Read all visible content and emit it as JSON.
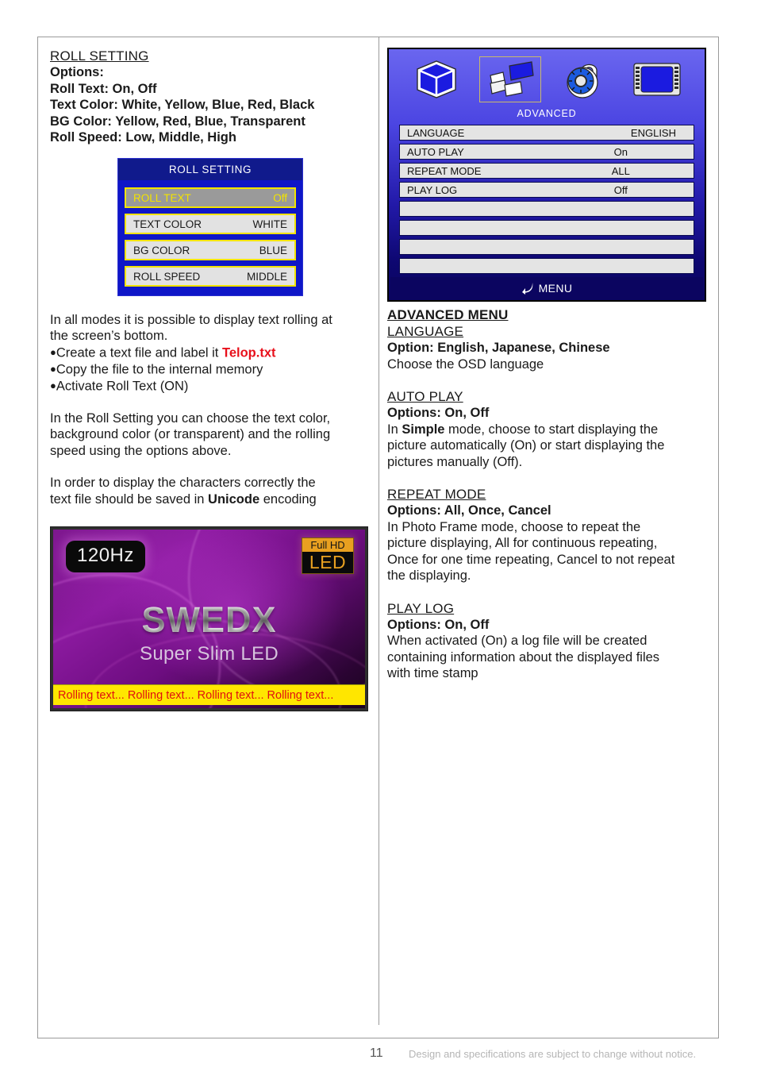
{
  "left": {
    "heading": "ROLL SETTING",
    "options_label": "Options:",
    "option_lines": [
      "Roll Text: On, Off",
      "Text Color: White, Yellow, Blue, Red, Black",
      "BG Color: Yellow, Red, Blue, Transparent",
      "Roll Speed: Low, Middle, High"
    ],
    "roll_osd": {
      "title": "ROLL SETTING",
      "rows": [
        {
          "key": "ROLL TEXT",
          "value": "Off",
          "selected": true
        },
        {
          "key": "TEXT COLOR",
          "value": "WHITE",
          "selected": false
        },
        {
          "key": "BG COLOR",
          "value": "BLUE",
          "selected": false
        },
        {
          "key": "ROLL SPEED",
          "value": "MIDDLE",
          "selected": false
        }
      ]
    },
    "intro_line1": "In all modes it is possible to display text rolling at",
    "intro_line2": "the screen’s bottom.",
    "bullet1_pre": "Create a text file and label it ",
    "bullet1_file": "Telop.txt",
    "bullet2": "Copy the file to the internal memory",
    "bullet3": "Activate Roll Text (ON)",
    "para2_line1": "In the Roll Setting you can choose the text color,",
    "para2_line2": "background color (or transparent) and the rolling",
    "para2_line3": "speed using the options above.",
    "para3_line1": "In order to display the characters correctly the",
    "para3_line2_pre": "text file should be saved in ",
    "para3_line2_bold": "Unicode",
    "para3_line2_post": " encoding",
    "tv_image": {
      "badge_refresh": "120Hz",
      "badge_hd_top": "Full HD",
      "badge_hd_bottom": "LED",
      "logo": "SWEDX",
      "tagline": "Super Slim LED",
      "rolling_text": "Rolling text... Rolling text... Rolling text... Rolling text...",
      "rolling_bar_bg": "#ffe600",
      "rolling_bar_fg": "#e01010"
    }
  },
  "right": {
    "advanced_osd": {
      "icons": [
        {
          "name": "cube-icon",
          "selected": false
        },
        {
          "name": "advanced-icon",
          "selected": true
        },
        {
          "name": "lock-icon",
          "selected": false
        },
        {
          "name": "screen-icon",
          "selected": false
        }
      ],
      "label": "ADVANCED",
      "rows": [
        {
          "key": "LANGUAGE",
          "value": "ENGLISH",
          "align": "right"
        },
        {
          "key": "AUTO PLAY",
          "value": "On",
          "align": "center"
        },
        {
          "key": "REPEAT MODE",
          "value": "ALL",
          "align": "center"
        },
        {
          "key": "PLAY LOG",
          "value": "Off",
          "align": "center"
        }
      ],
      "empty_row_count": 4,
      "footer_label": "MENU"
    },
    "heading": "ADVANCED MENU",
    "sections": [
      {
        "title": "LANGUAGE",
        "options": "Option: English, Japanese, Chinese",
        "body": [
          "Choose the OSD language"
        ]
      },
      {
        "title": "AUTO PLAY",
        "options": "Options: On, Off",
        "body": [
          "In Simple mode, choose to start displaying the",
          "picture automatically (On) or start displaying the",
          "pictures manually (Off)."
        ],
        "body_bold_word": "Simple"
      },
      {
        "title": "REPEAT MODE",
        "options": "Options: All, Once, Cancel",
        "body": [
          "In Photo Frame mode, choose to repeat the",
          "picture displaying, All for continuous repeating,",
          "Once for one time repeating, Cancel to not repeat",
          "the displaying."
        ]
      },
      {
        "title": "PLAY LOG",
        "options": "Options: On, Off",
        "body": [
          "When activated (On) a log file will be created",
          "containing information about the displayed files",
          "with time stamp"
        ]
      }
    ]
  },
  "footer": {
    "page_number": "11",
    "note": "Design and specifications are subject to change without notice."
  }
}
